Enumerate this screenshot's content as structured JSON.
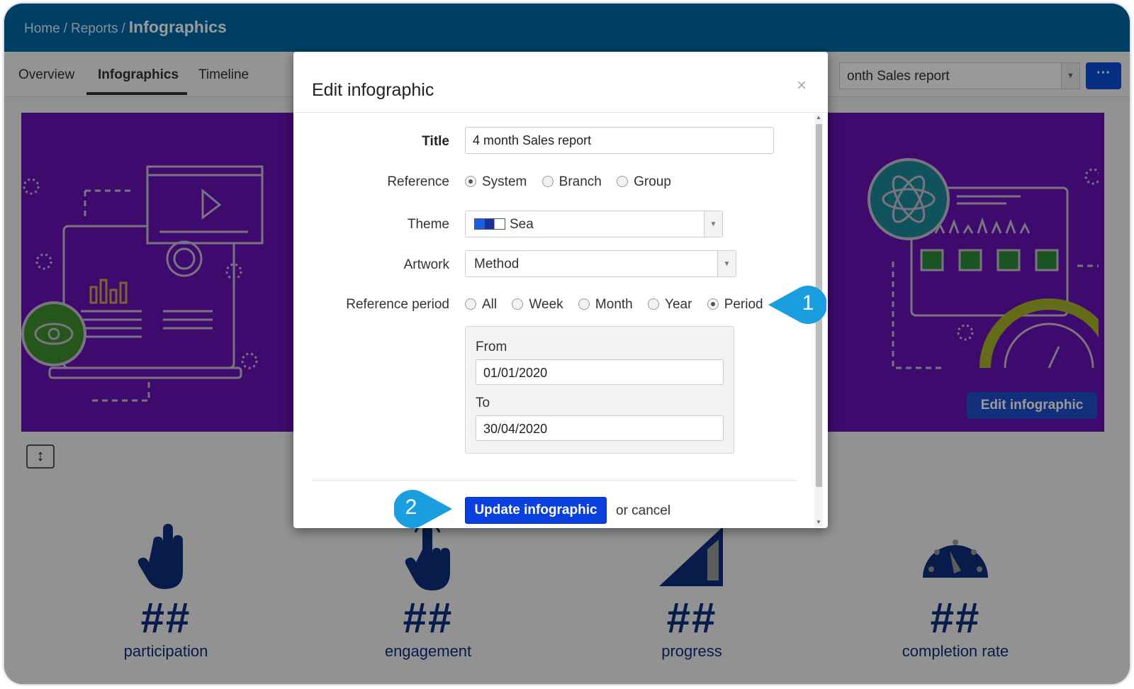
{
  "breadcrumb": {
    "home": "Home",
    "reports": "Reports",
    "current": "Infographics",
    "separator": "/"
  },
  "tabs": [
    {
      "label": "Overview"
    },
    {
      "label": "Infographics"
    },
    {
      "label": "Timeline"
    }
  ],
  "report_select": {
    "value": "onth Sales report"
  },
  "more_button": {
    "label": "···"
  },
  "banner": {
    "edit_button": "Edit infographic"
  },
  "resize_button": {
    "label": "↕"
  },
  "stats": [
    {
      "value": "##",
      "label": "participation",
      "icon": "hand-icon"
    },
    {
      "value": "##",
      "label": "engagement",
      "icon": "pointer-hand-icon"
    },
    {
      "value": "##",
      "label": "progress",
      "icon": "progress-ramp-icon"
    },
    {
      "value": "##",
      "label": "completion rate",
      "icon": "gauge-icon"
    }
  ],
  "modal": {
    "title": "Edit infographic",
    "close": "×",
    "fields": {
      "title_label": "Title",
      "title_value": "4 month Sales report",
      "reference_label": "Reference",
      "reference_options": [
        "System",
        "Branch",
        "Group"
      ],
      "reference_selected": "System",
      "theme_label": "Theme",
      "theme_value": "Sea",
      "artwork_label": "Artwork",
      "artwork_value": "Method",
      "period_label": "Reference period",
      "period_options": [
        "All",
        "Week",
        "Month",
        "Year",
        "Period"
      ],
      "period_selected": "Period",
      "from_label": "From",
      "from_value": "01/01/2020",
      "to_label": "To",
      "to_value": "30/04/2020"
    },
    "update_button": "Update infographic",
    "cancel_text": "or cancel"
  },
  "callouts": [
    {
      "number": "1"
    },
    {
      "number": "2"
    }
  ],
  "colors": {
    "topbar": "#016aa8",
    "banner": "#6a12b8",
    "primary_button": "#0a3fe0",
    "stat_text": "#0d2f7c",
    "callout": "#1b9ee0"
  }
}
